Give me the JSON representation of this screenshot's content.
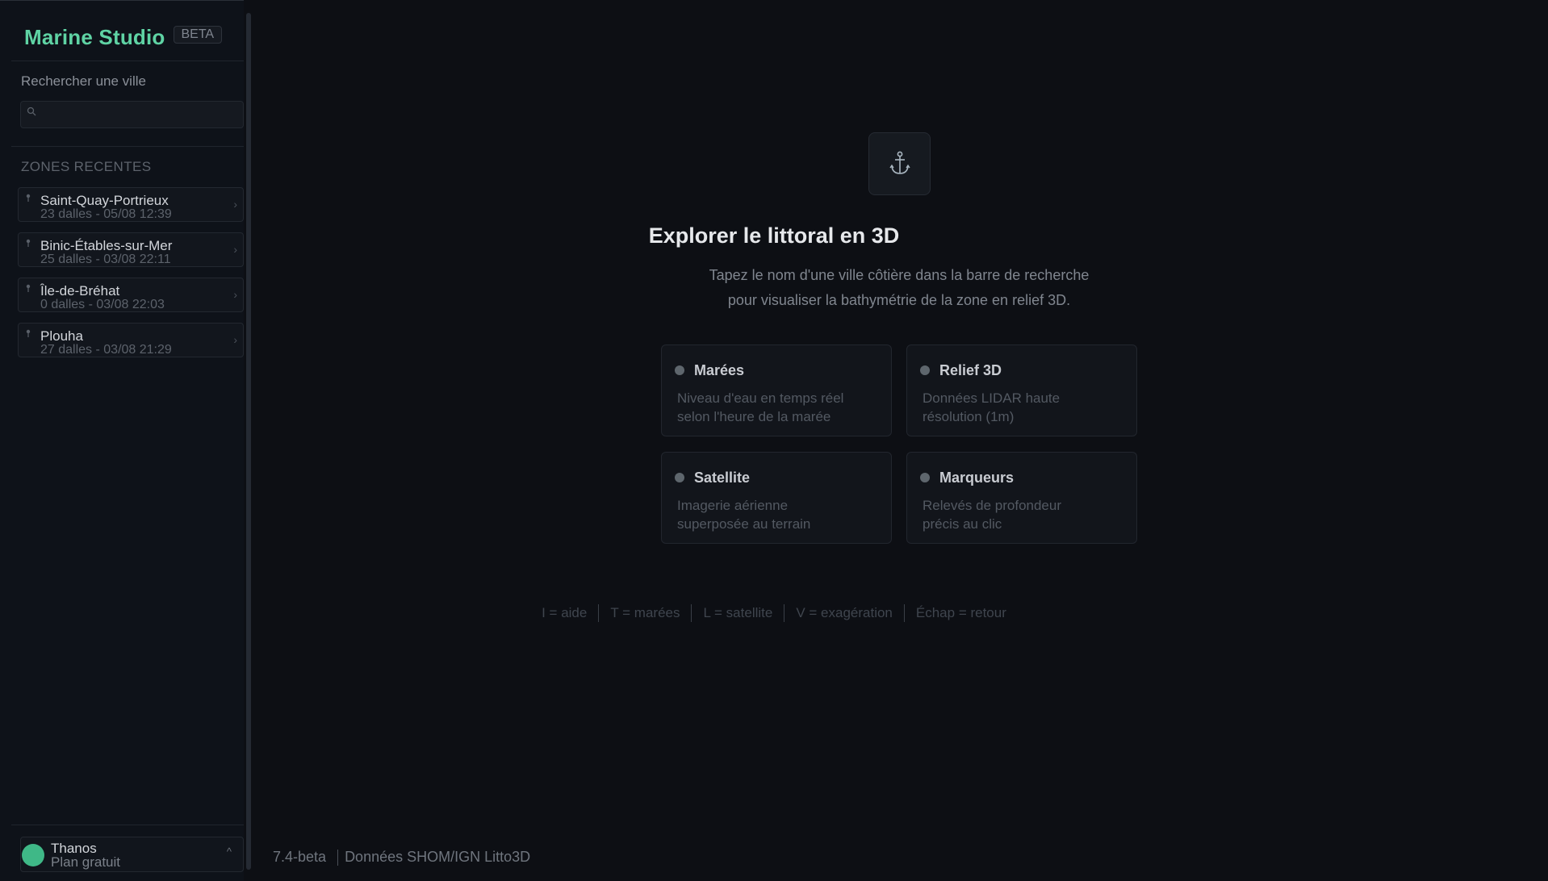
{
  "brand": {
    "name": "Marine Studio",
    "badge": "BETA"
  },
  "search": {
    "label": "Rechercher une ville",
    "placeholder": "",
    "value": ""
  },
  "recent": {
    "title": "ZONES RECENTES",
    "items": [
      {
        "name": "Saint-Quay-Portrieux",
        "meta": "23 dalles - 05/08 12:39"
      },
      {
        "name": "Binic-Étables-sur-Mer",
        "meta": "25 dalles - 03/08 22:11"
      },
      {
        "name": "Île-de-Bréhat",
        "meta": "0 dalles - 03/08 22:03"
      },
      {
        "name": "Plouha",
        "meta": "27 dalles - 03/08 21:29"
      }
    ]
  },
  "user": {
    "name": "Thanos",
    "plan": "Plan gratuit",
    "avatar_color": "#3fb887"
  },
  "hero": {
    "icon": "anchor-icon",
    "title": "Explorer le littoral en 3D",
    "desc_line1": "Tapez le nom d'une ville côtière dans la barre de recherche",
    "desc_line2": "pour visualiser la bathymétrie de la zone en relief 3D."
  },
  "features": [
    {
      "title": "Marées",
      "line1": "Niveau d'eau en temps réel",
      "line2": "selon l'heure de la marée"
    },
    {
      "title": "Relief 3D",
      "line1": "Données LIDAR haute",
      "line2": "résolution (1m)"
    },
    {
      "title": "Satellite",
      "line1": "Imagerie aérienne",
      "line2": "superposée au terrain"
    },
    {
      "title": "Marqueurs",
      "line1": "Relevés de profondeur",
      "line2": "précis au clic"
    }
  ],
  "shortcuts": [
    "I = aide",
    "T = marées",
    "L = satellite",
    "V = exagération",
    "Échap = retour"
  ],
  "footer": {
    "version": "7.4-beta",
    "source": "Données SHOM/IGN Litto3D"
  },
  "colors": {
    "accent": "#5fd3a4",
    "background": "#0d0f14",
    "sidebar": "#0e1219"
  }
}
